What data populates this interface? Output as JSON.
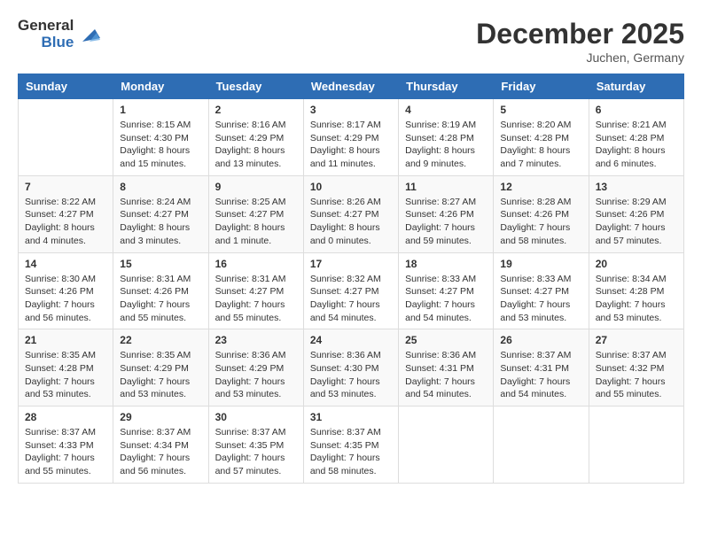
{
  "header": {
    "logo_general": "General",
    "logo_blue": "Blue",
    "month_title": "December 2025",
    "location": "Juchen, Germany"
  },
  "calendar": {
    "days_of_week": [
      "Sunday",
      "Monday",
      "Tuesday",
      "Wednesday",
      "Thursday",
      "Friday",
      "Saturday"
    ],
    "weeks": [
      [
        {
          "day": "",
          "info": ""
        },
        {
          "day": "1",
          "info": "Sunrise: 8:15 AM\nSunset: 4:30 PM\nDaylight: 8 hours\nand 15 minutes."
        },
        {
          "day": "2",
          "info": "Sunrise: 8:16 AM\nSunset: 4:29 PM\nDaylight: 8 hours\nand 13 minutes."
        },
        {
          "day": "3",
          "info": "Sunrise: 8:17 AM\nSunset: 4:29 PM\nDaylight: 8 hours\nand 11 minutes."
        },
        {
          "day": "4",
          "info": "Sunrise: 8:19 AM\nSunset: 4:28 PM\nDaylight: 8 hours\nand 9 minutes."
        },
        {
          "day": "5",
          "info": "Sunrise: 8:20 AM\nSunset: 4:28 PM\nDaylight: 8 hours\nand 7 minutes."
        },
        {
          "day": "6",
          "info": "Sunrise: 8:21 AM\nSunset: 4:28 PM\nDaylight: 8 hours\nand 6 minutes."
        }
      ],
      [
        {
          "day": "7",
          "info": "Sunrise: 8:22 AM\nSunset: 4:27 PM\nDaylight: 8 hours\nand 4 minutes."
        },
        {
          "day": "8",
          "info": "Sunrise: 8:24 AM\nSunset: 4:27 PM\nDaylight: 8 hours\nand 3 minutes."
        },
        {
          "day": "9",
          "info": "Sunrise: 8:25 AM\nSunset: 4:27 PM\nDaylight: 8 hours\nand 1 minute."
        },
        {
          "day": "10",
          "info": "Sunrise: 8:26 AM\nSunset: 4:27 PM\nDaylight: 8 hours\nand 0 minutes."
        },
        {
          "day": "11",
          "info": "Sunrise: 8:27 AM\nSunset: 4:26 PM\nDaylight: 7 hours\nand 59 minutes."
        },
        {
          "day": "12",
          "info": "Sunrise: 8:28 AM\nSunset: 4:26 PM\nDaylight: 7 hours\nand 58 minutes."
        },
        {
          "day": "13",
          "info": "Sunrise: 8:29 AM\nSunset: 4:26 PM\nDaylight: 7 hours\nand 57 minutes."
        }
      ],
      [
        {
          "day": "14",
          "info": "Sunrise: 8:30 AM\nSunset: 4:26 PM\nDaylight: 7 hours\nand 56 minutes."
        },
        {
          "day": "15",
          "info": "Sunrise: 8:31 AM\nSunset: 4:26 PM\nDaylight: 7 hours\nand 55 minutes."
        },
        {
          "day": "16",
          "info": "Sunrise: 8:31 AM\nSunset: 4:27 PM\nDaylight: 7 hours\nand 55 minutes."
        },
        {
          "day": "17",
          "info": "Sunrise: 8:32 AM\nSunset: 4:27 PM\nDaylight: 7 hours\nand 54 minutes."
        },
        {
          "day": "18",
          "info": "Sunrise: 8:33 AM\nSunset: 4:27 PM\nDaylight: 7 hours\nand 54 minutes."
        },
        {
          "day": "19",
          "info": "Sunrise: 8:33 AM\nSunset: 4:27 PM\nDaylight: 7 hours\nand 53 minutes."
        },
        {
          "day": "20",
          "info": "Sunrise: 8:34 AM\nSunset: 4:28 PM\nDaylight: 7 hours\nand 53 minutes."
        }
      ],
      [
        {
          "day": "21",
          "info": "Sunrise: 8:35 AM\nSunset: 4:28 PM\nDaylight: 7 hours\nand 53 minutes."
        },
        {
          "day": "22",
          "info": "Sunrise: 8:35 AM\nSunset: 4:29 PM\nDaylight: 7 hours\nand 53 minutes."
        },
        {
          "day": "23",
          "info": "Sunrise: 8:36 AM\nSunset: 4:29 PM\nDaylight: 7 hours\nand 53 minutes."
        },
        {
          "day": "24",
          "info": "Sunrise: 8:36 AM\nSunset: 4:30 PM\nDaylight: 7 hours\nand 53 minutes."
        },
        {
          "day": "25",
          "info": "Sunrise: 8:36 AM\nSunset: 4:31 PM\nDaylight: 7 hours\nand 54 minutes."
        },
        {
          "day": "26",
          "info": "Sunrise: 8:37 AM\nSunset: 4:31 PM\nDaylight: 7 hours\nand 54 minutes."
        },
        {
          "day": "27",
          "info": "Sunrise: 8:37 AM\nSunset: 4:32 PM\nDaylight: 7 hours\nand 55 minutes."
        }
      ],
      [
        {
          "day": "28",
          "info": "Sunrise: 8:37 AM\nSunset: 4:33 PM\nDaylight: 7 hours\nand 55 minutes."
        },
        {
          "day": "29",
          "info": "Sunrise: 8:37 AM\nSunset: 4:34 PM\nDaylight: 7 hours\nand 56 minutes."
        },
        {
          "day": "30",
          "info": "Sunrise: 8:37 AM\nSunset: 4:35 PM\nDaylight: 7 hours\nand 57 minutes."
        },
        {
          "day": "31",
          "info": "Sunrise: 8:37 AM\nSunset: 4:35 PM\nDaylight: 7 hours\nand 58 minutes."
        },
        {
          "day": "",
          "info": ""
        },
        {
          "day": "",
          "info": ""
        },
        {
          "day": "",
          "info": ""
        }
      ]
    ]
  }
}
